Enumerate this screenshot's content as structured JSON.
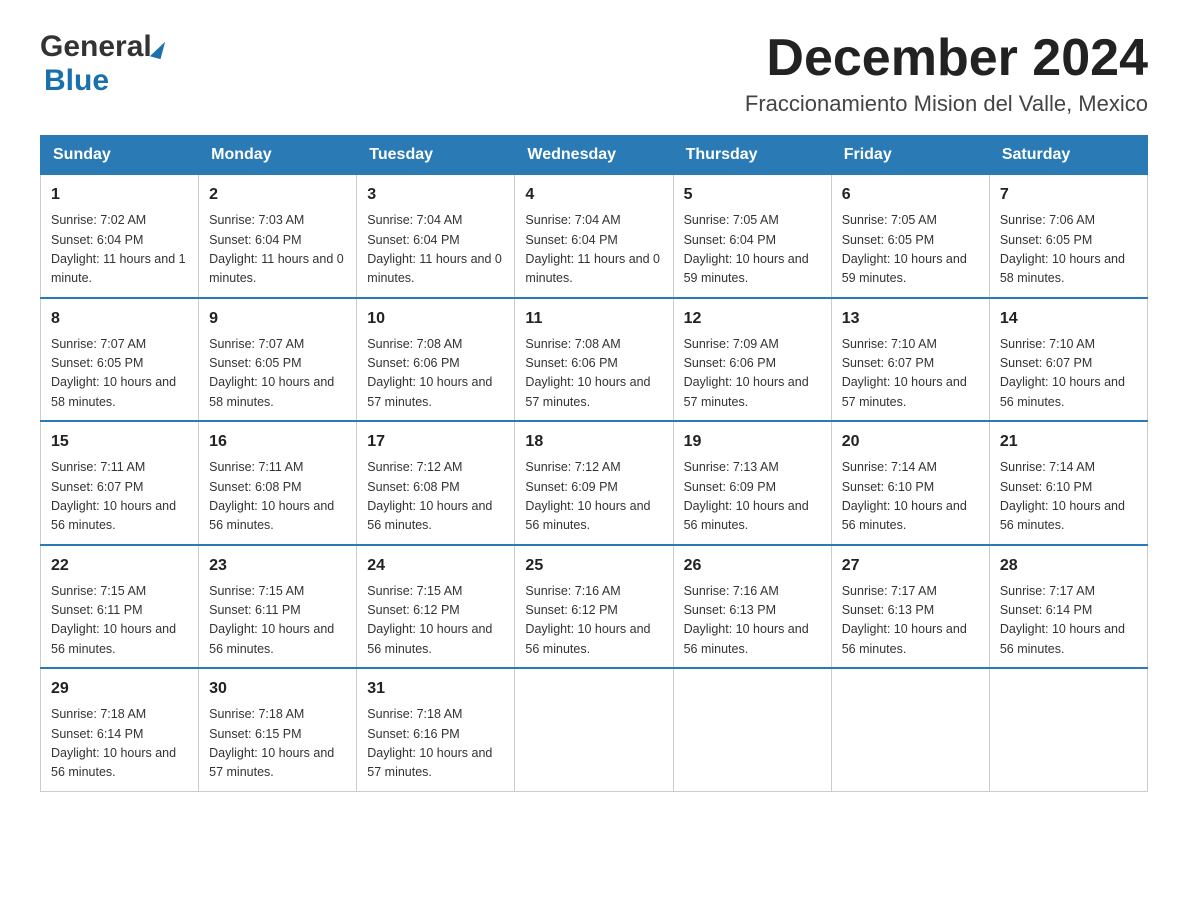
{
  "header": {
    "logo_general": "General",
    "logo_blue": "Blue",
    "month_title": "December 2024",
    "location": "Fraccionamiento Mision del Valle, Mexico"
  },
  "weekdays": [
    "Sunday",
    "Monday",
    "Tuesday",
    "Wednesday",
    "Thursday",
    "Friday",
    "Saturday"
  ],
  "weeks": [
    [
      {
        "day": "1",
        "sunrise": "7:02 AM",
        "sunset": "6:04 PM",
        "daylight": "11 hours and 1 minute."
      },
      {
        "day": "2",
        "sunrise": "7:03 AM",
        "sunset": "6:04 PM",
        "daylight": "11 hours and 0 minutes."
      },
      {
        "day": "3",
        "sunrise": "7:04 AM",
        "sunset": "6:04 PM",
        "daylight": "11 hours and 0 minutes."
      },
      {
        "day": "4",
        "sunrise": "7:04 AM",
        "sunset": "6:04 PM",
        "daylight": "11 hours and 0 minutes."
      },
      {
        "day": "5",
        "sunrise": "7:05 AM",
        "sunset": "6:04 PM",
        "daylight": "10 hours and 59 minutes."
      },
      {
        "day": "6",
        "sunrise": "7:05 AM",
        "sunset": "6:05 PM",
        "daylight": "10 hours and 59 minutes."
      },
      {
        "day": "7",
        "sunrise": "7:06 AM",
        "sunset": "6:05 PM",
        "daylight": "10 hours and 58 minutes."
      }
    ],
    [
      {
        "day": "8",
        "sunrise": "7:07 AM",
        "sunset": "6:05 PM",
        "daylight": "10 hours and 58 minutes."
      },
      {
        "day": "9",
        "sunrise": "7:07 AM",
        "sunset": "6:05 PM",
        "daylight": "10 hours and 58 minutes."
      },
      {
        "day": "10",
        "sunrise": "7:08 AM",
        "sunset": "6:06 PM",
        "daylight": "10 hours and 57 minutes."
      },
      {
        "day": "11",
        "sunrise": "7:08 AM",
        "sunset": "6:06 PM",
        "daylight": "10 hours and 57 minutes."
      },
      {
        "day": "12",
        "sunrise": "7:09 AM",
        "sunset": "6:06 PM",
        "daylight": "10 hours and 57 minutes."
      },
      {
        "day": "13",
        "sunrise": "7:10 AM",
        "sunset": "6:07 PM",
        "daylight": "10 hours and 57 minutes."
      },
      {
        "day": "14",
        "sunrise": "7:10 AM",
        "sunset": "6:07 PM",
        "daylight": "10 hours and 56 minutes."
      }
    ],
    [
      {
        "day": "15",
        "sunrise": "7:11 AM",
        "sunset": "6:07 PM",
        "daylight": "10 hours and 56 minutes."
      },
      {
        "day": "16",
        "sunrise": "7:11 AM",
        "sunset": "6:08 PM",
        "daylight": "10 hours and 56 minutes."
      },
      {
        "day": "17",
        "sunrise": "7:12 AM",
        "sunset": "6:08 PM",
        "daylight": "10 hours and 56 minutes."
      },
      {
        "day": "18",
        "sunrise": "7:12 AM",
        "sunset": "6:09 PM",
        "daylight": "10 hours and 56 minutes."
      },
      {
        "day": "19",
        "sunrise": "7:13 AM",
        "sunset": "6:09 PM",
        "daylight": "10 hours and 56 minutes."
      },
      {
        "day": "20",
        "sunrise": "7:14 AM",
        "sunset": "6:10 PM",
        "daylight": "10 hours and 56 minutes."
      },
      {
        "day": "21",
        "sunrise": "7:14 AM",
        "sunset": "6:10 PM",
        "daylight": "10 hours and 56 minutes."
      }
    ],
    [
      {
        "day": "22",
        "sunrise": "7:15 AM",
        "sunset": "6:11 PM",
        "daylight": "10 hours and 56 minutes."
      },
      {
        "day": "23",
        "sunrise": "7:15 AM",
        "sunset": "6:11 PM",
        "daylight": "10 hours and 56 minutes."
      },
      {
        "day": "24",
        "sunrise": "7:15 AM",
        "sunset": "6:12 PM",
        "daylight": "10 hours and 56 minutes."
      },
      {
        "day": "25",
        "sunrise": "7:16 AM",
        "sunset": "6:12 PM",
        "daylight": "10 hours and 56 minutes."
      },
      {
        "day": "26",
        "sunrise": "7:16 AM",
        "sunset": "6:13 PM",
        "daylight": "10 hours and 56 minutes."
      },
      {
        "day": "27",
        "sunrise": "7:17 AM",
        "sunset": "6:13 PM",
        "daylight": "10 hours and 56 minutes."
      },
      {
        "day": "28",
        "sunrise": "7:17 AM",
        "sunset": "6:14 PM",
        "daylight": "10 hours and 56 minutes."
      }
    ],
    [
      {
        "day": "29",
        "sunrise": "7:18 AM",
        "sunset": "6:14 PM",
        "daylight": "10 hours and 56 minutes."
      },
      {
        "day": "30",
        "sunrise": "7:18 AM",
        "sunset": "6:15 PM",
        "daylight": "10 hours and 57 minutes."
      },
      {
        "day": "31",
        "sunrise": "7:18 AM",
        "sunset": "6:16 PM",
        "daylight": "10 hours and 57 minutes."
      },
      null,
      null,
      null,
      null
    ]
  ]
}
